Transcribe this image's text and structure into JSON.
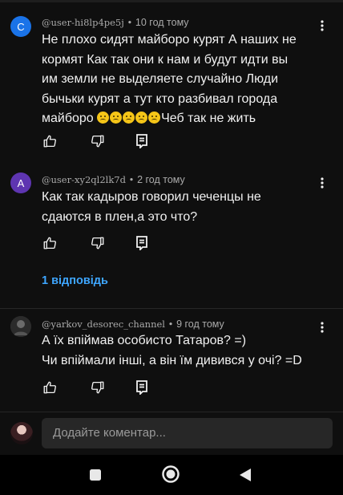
{
  "comments": [
    {
      "avatar_letter": "C",
      "avatar_color": "#1a73e8",
      "author": "@user-hi8lp4pe5j",
      "time": "10 год тому",
      "lines": [
        "Не плохо сидят майборо курят А наших не",
        "кормят Как так они к нам и будут идти вы",
        "им земли не выделяете случайно Люди",
        "бычьки курят а тут кто разбивал города"
      ],
      "last_line_prefix": "майборо ",
      "emoji_name": "sad-face-emoji",
      "emoji_count": 5,
      "last_line_suffix": "Чеб так не жить"
    },
    {
      "avatar_letter": "A",
      "avatar_color": "#5e35b1",
      "author": "@user-xy2ql2lk7d",
      "time": "2 год тому",
      "lines": [
        "Как так кадыров говорил чеченцы не",
        "сдаются в плен,а это что?"
      ],
      "replies_label": "1 відповідь"
    },
    {
      "avatar_letter": "",
      "avatar_color": "#3a3a3a",
      "author": "@yarkov_desorec_channel",
      "time": "9 год тому",
      "lines": [
        "А їх впіймав особисто Татаров? =)",
        "Чи впіймали інші, а він їм дивився у очі? =D"
      ]
    }
  ],
  "input": {
    "placeholder": "Додайте коментар..."
  },
  "colors": {
    "background": "#0f0f0f",
    "link": "#3ea6ff",
    "meta_text": "#aaaaaa"
  }
}
